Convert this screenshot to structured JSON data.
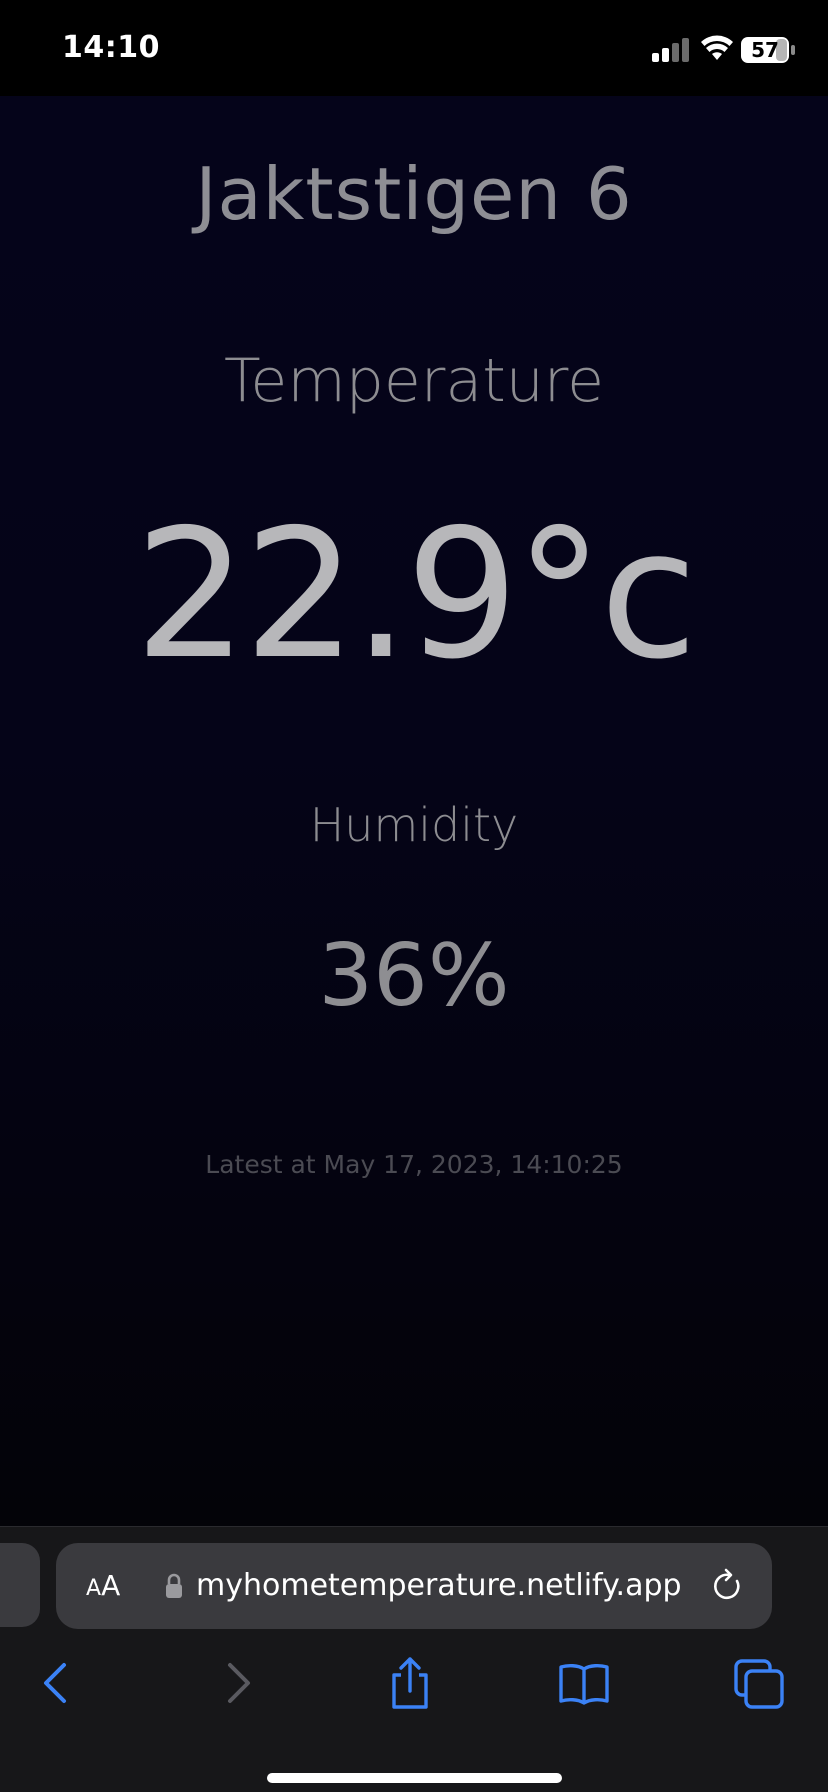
{
  "status_bar": {
    "time": "14:10",
    "battery_level": "57",
    "icons": [
      "signal-icon",
      "wifi-icon",
      "battery-icon"
    ]
  },
  "page": {
    "heading": "Jaktstigen 6",
    "temperature": {
      "label": "Temperature",
      "value": "22.9°c"
    },
    "humidity": {
      "label": "Humidity",
      "value": "36%"
    },
    "latest": "Latest at May 17, 2023, 14:10:25"
  },
  "browser": {
    "text_size_label_small": "A",
    "text_size_label_large": "A",
    "url": "myhometemperature.netlify.app",
    "icons": [
      "lock-icon",
      "reload-icon",
      "back-icon",
      "forward-icon",
      "share-icon",
      "bookmarks-icon",
      "tabs-icon"
    ],
    "accent_color": "#3b82f6",
    "disabled_color": "#5a5a60"
  }
}
